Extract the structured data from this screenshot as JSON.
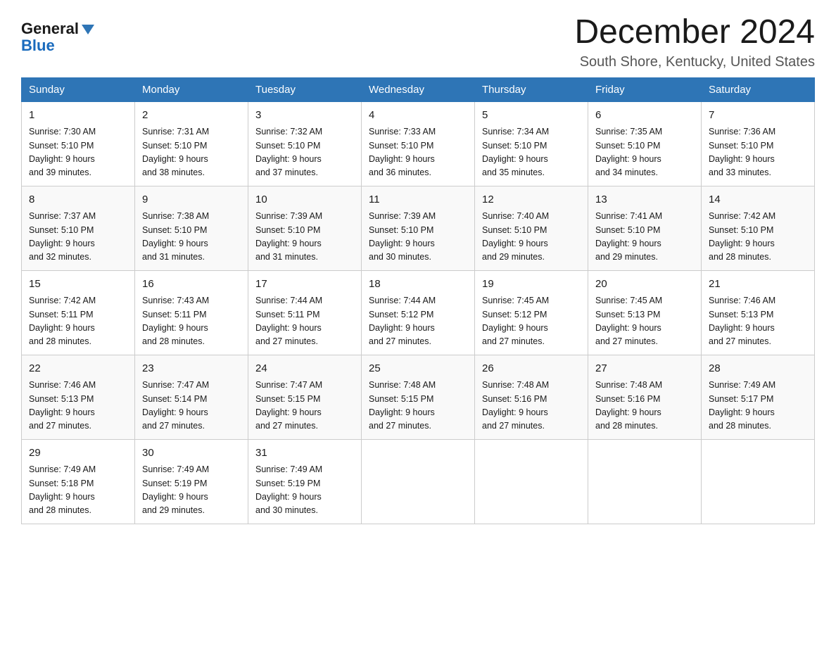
{
  "logo": {
    "line1": "General",
    "triangle_color": "#2e75b6",
    "line2": "Blue"
  },
  "title": "December 2024",
  "subtitle": "South Shore, Kentucky, United States",
  "days_of_week": [
    "Sunday",
    "Monday",
    "Tuesday",
    "Wednesday",
    "Thursday",
    "Friday",
    "Saturday"
  ],
  "weeks": [
    [
      {
        "day": "1",
        "sunrise": "7:30 AM",
        "sunset": "5:10 PM",
        "daylight": "9 hours and 39 minutes."
      },
      {
        "day": "2",
        "sunrise": "7:31 AM",
        "sunset": "5:10 PM",
        "daylight": "9 hours and 38 minutes."
      },
      {
        "day": "3",
        "sunrise": "7:32 AM",
        "sunset": "5:10 PM",
        "daylight": "9 hours and 37 minutes."
      },
      {
        "day": "4",
        "sunrise": "7:33 AM",
        "sunset": "5:10 PM",
        "daylight": "9 hours and 36 minutes."
      },
      {
        "day": "5",
        "sunrise": "7:34 AM",
        "sunset": "5:10 PM",
        "daylight": "9 hours and 35 minutes."
      },
      {
        "day": "6",
        "sunrise": "7:35 AM",
        "sunset": "5:10 PM",
        "daylight": "9 hours and 34 minutes."
      },
      {
        "day": "7",
        "sunrise": "7:36 AM",
        "sunset": "5:10 PM",
        "daylight": "9 hours and 33 minutes."
      }
    ],
    [
      {
        "day": "8",
        "sunrise": "7:37 AM",
        "sunset": "5:10 PM",
        "daylight": "9 hours and 32 minutes."
      },
      {
        "day": "9",
        "sunrise": "7:38 AM",
        "sunset": "5:10 PM",
        "daylight": "9 hours and 31 minutes."
      },
      {
        "day": "10",
        "sunrise": "7:39 AM",
        "sunset": "5:10 PM",
        "daylight": "9 hours and 31 minutes."
      },
      {
        "day": "11",
        "sunrise": "7:39 AM",
        "sunset": "5:10 PM",
        "daylight": "9 hours and 30 minutes."
      },
      {
        "day": "12",
        "sunrise": "7:40 AM",
        "sunset": "5:10 PM",
        "daylight": "9 hours and 29 minutes."
      },
      {
        "day": "13",
        "sunrise": "7:41 AM",
        "sunset": "5:10 PM",
        "daylight": "9 hours and 29 minutes."
      },
      {
        "day": "14",
        "sunrise": "7:42 AM",
        "sunset": "5:10 PM",
        "daylight": "9 hours and 28 minutes."
      }
    ],
    [
      {
        "day": "15",
        "sunrise": "7:42 AM",
        "sunset": "5:11 PM",
        "daylight": "9 hours and 28 minutes."
      },
      {
        "day": "16",
        "sunrise": "7:43 AM",
        "sunset": "5:11 PM",
        "daylight": "9 hours and 28 minutes."
      },
      {
        "day": "17",
        "sunrise": "7:44 AM",
        "sunset": "5:11 PM",
        "daylight": "9 hours and 27 minutes."
      },
      {
        "day": "18",
        "sunrise": "7:44 AM",
        "sunset": "5:12 PM",
        "daylight": "9 hours and 27 minutes."
      },
      {
        "day": "19",
        "sunrise": "7:45 AM",
        "sunset": "5:12 PM",
        "daylight": "9 hours and 27 minutes."
      },
      {
        "day": "20",
        "sunrise": "7:45 AM",
        "sunset": "5:13 PM",
        "daylight": "9 hours and 27 minutes."
      },
      {
        "day": "21",
        "sunrise": "7:46 AM",
        "sunset": "5:13 PM",
        "daylight": "9 hours and 27 minutes."
      }
    ],
    [
      {
        "day": "22",
        "sunrise": "7:46 AM",
        "sunset": "5:13 PM",
        "daylight": "9 hours and 27 minutes."
      },
      {
        "day": "23",
        "sunrise": "7:47 AM",
        "sunset": "5:14 PM",
        "daylight": "9 hours and 27 minutes."
      },
      {
        "day": "24",
        "sunrise": "7:47 AM",
        "sunset": "5:15 PM",
        "daylight": "9 hours and 27 minutes."
      },
      {
        "day": "25",
        "sunrise": "7:48 AM",
        "sunset": "5:15 PM",
        "daylight": "9 hours and 27 minutes."
      },
      {
        "day": "26",
        "sunrise": "7:48 AM",
        "sunset": "5:16 PM",
        "daylight": "9 hours and 27 minutes."
      },
      {
        "day": "27",
        "sunrise": "7:48 AM",
        "sunset": "5:16 PM",
        "daylight": "9 hours and 28 minutes."
      },
      {
        "day": "28",
        "sunrise": "7:49 AM",
        "sunset": "5:17 PM",
        "daylight": "9 hours and 28 minutes."
      }
    ],
    [
      {
        "day": "29",
        "sunrise": "7:49 AM",
        "sunset": "5:18 PM",
        "daylight": "9 hours and 28 minutes."
      },
      {
        "day": "30",
        "sunrise": "7:49 AM",
        "sunset": "5:19 PM",
        "daylight": "9 hours and 29 minutes."
      },
      {
        "day": "31",
        "sunrise": "7:49 AM",
        "sunset": "5:19 PM",
        "daylight": "9 hours and 30 minutes."
      },
      null,
      null,
      null,
      null
    ]
  ]
}
